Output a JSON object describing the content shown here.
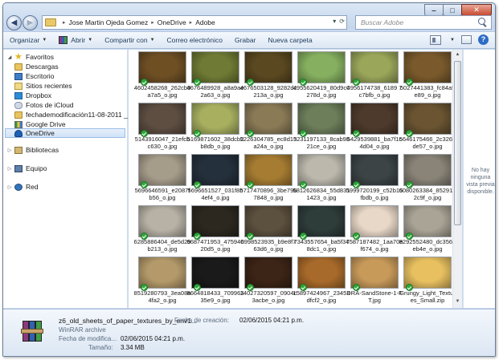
{
  "window": {
    "minimize": "‒",
    "maximize": "□",
    "close": "✕"
  },
  "address": {
    "crumbs": [
      "Jose Martin Ojeda Gomez",
      "OneDrive",
      "Adobe"
    ],
    "search_placeholder": "Buscar Adobe"
  },
  "toolbar": {
    "organize": "Organizar",
    "open": "Abrir",
    "share": "Compartir con",
    "email": "Correo electrónico",
    "burn": "Grabar",
    "new_folder": "Nueva carpeta"
  },
  "sidebar": {
    "favorites": "Favoritos",
    "items": [
      "Descargas",
      "Escritorio",
      "Sitios recientes",
      "Dropbox",
      "Fotos de iCloud",
      "fechademodificación11-08-2011 _ 16-08-...",
      "Google Drive",
      "OneDrive"
    ],
    "libraries": "Bibliotecas",
    "computer": "Equipo",
    "network": "Red"
  },
  "files": [
    {
      "name": "4602458268_262cb9a7a5_o.jpg",
      "color": "#6e4f24"
    },
    {
      "name": "4676489928_a8a9ae2a63_o.jpg",
      "color": "#6f7a34"
    },
    {
      "name": "4676503128_9282dc213a_o.jpg",
      "color": "#5a4820"
    },
    {
      "name": "4955620419_80d9c0278d_o.jpg",
      "color": "#86b060"
    },
    {
      "name": "4956174738_6189 7c7bfb_o.jpg",
      "color": "#9aa65a"
    },
    {
      "name": "5027441383_fc84affe89_o.jpg",
      "color": "#7a5a2c"
    },
    {
      "name": "5143916047_21efcbc630_o.jpg",
      "color": "#5e4e42"
    },
    {
      "name": "5169871602_38dcb2b8db_o.jpg",
      "color": "#a8b060"
    },
    {
      "name": "5226304785_ec8d13a24a_o.jpg",
      "color": "#8a7a56"
    },
    {
      "name": "5231197133_8cab9821ce_o.jpg",
      "color": "#6c7e5a"
    },
    {
      "name": "5429539881_ba7f1c4d04_o.jpg",
      "color": "#4e3a2c"
    },
    {
      "name": "5646175466_2c3262de57_o.jpg",
      "color": "#6a5432"
    },
    {
      "name": "5696646591_e2087fb56_o.jpg",
      "color": "#a69c8a"
    },
    {
      "name": "5696651527_031f8b4ef4_o.jpg",
      "color": "#24303c"
    },
    {
      "name": "5717470896_3be7967848_o.jpg",
      "color": "#a67c32"
    },
    {
      "name": "5812626834_55d8311423_o.jpg",
      "color": "#bcb8ac"
    },
    {
      "name": "5999720199_c52b15fbdb_o.jpg",
      "color": "#3c4446"
    },
    {
      "name": "6080263384_85291e2c9f_o.jpg",
      "color": "#8a8478"
    },
    {
      "name": "6285886404_de5d29b213_o.jpg",
      "color": "#b8b2a6"
    },
    {
      "name": "6687471953_47594020d5_o.jpg",
      "color": "#2c2820"
    },
    {
      "name": "6998523935_b9e8f763d6_o.jpg",
      "color": "#5c503e"
    },
    {
      "name": "7343557654_ba5f348dc1_o.jpg",
      "color": "#2e3c3a"
    },
    {
      "name": "7587187482_1aa70ef674_o.jpg",
      "color": "#e8d8c8"
    },
    {
      "name": "8292552480_dc3564eb4e_o.jpg",
      "color": "#aaa496"
    },
    {
      "name": "8519280793_3ea08a4fa2_o.jpg",
      "color": "#b49a6a"
    },
    {
      "name": "8664818433_70996335e9_o.jpg",
      "color": "#1a1a1a"
    },
    {
      "name": "14027320597_0904c3acbe_o.jpg",
      "color": "#3c2416"
    },
    {
      "name": "15897424967_23453dfcf2_o.jpg",
      "color": "#a86a2a"
    },
    {
      "name": "DRA-SandStone-1-FT.jpg",
      "color": "#c89a5a"
    },
    {
      "name": "Grungy_Light_Textures_Small.zip",
      "color": "#e8c060"
    }
  ],
  "preview_text": "No hay ninguna vista previa disponible.",
  "details": {
    "name": "z6_old_sheets_of_paper_textures_by_env1...",
    "type": "WinRAR archive",
    "created_label": "Fecha de creación:",
    "created_value": "02/06/2015 04:21 p.m.",
    "modified_label": "Fecha de modifica...",
    "modified_value": "02/06/2015 04:21 p.m.",
    "size_label": "Tamaño:",
    "size_value": "3.34 MB"
  }
}
